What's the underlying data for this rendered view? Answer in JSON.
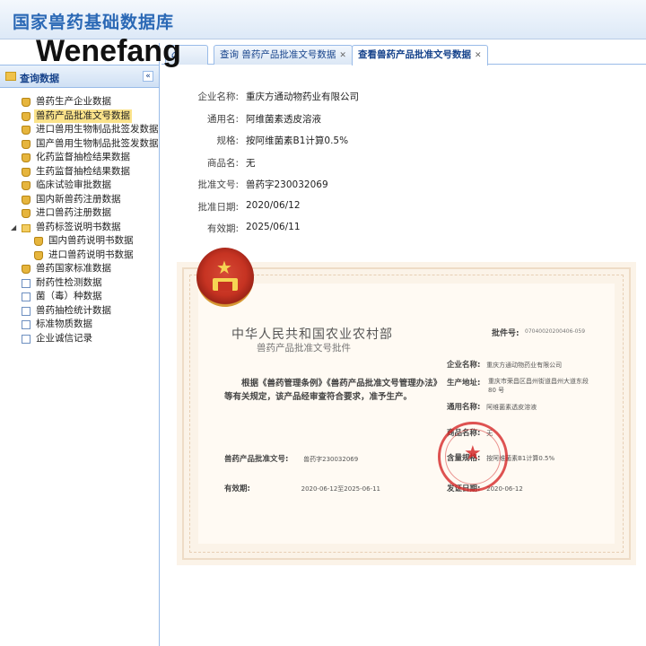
{
  "header": {
    "app_title": "国家兽药基础数据库",
    "watermark": "Wenefang"
  },
  "sidebar": {
    "title": "查询数据",
    "items": [
      {
        "label": "兽药生产企业数据",
        "icon": "database-icon",
        "level": 1
      },
      {
        "label": "兽药产品批准文号数据",
        "icon": "database-icon",
        "level": 1,
        "selected": true
      },
      {
        "label": "进口兽用生物制品批签发数据",
        "icon": "database-icon",
        "level": 1
      },
      {
        "label": "国产兽用生物制品批签发数据",
        "icon": "database-icon",
        "level": 1
      },
      {
        "label": "化药监督抽检结果数据",
        "icon": "database-icon",
        "level": 1
      },
      {
        "label": "生药监督抽检结果数据",
        "icon": "database-icon",
        "level": 1
      },
      {
        "label": "临床试验审批数据",
        "icon": "database-icon",
        "level": 1
      },
      {
        "label": "国内新兽药注册数据",
        "icon": "database-icon",
        "level": 1
      },
      {
        "label": "进口兽药注册数据",
        "icon": "database-icon",
        "level": 1
      },
      {
        "label": "兽药标签说明书数据",
        "icon": "folder-icon",
        "level": 1,
        "expanded": true
      },
      {
        "label": "国内兽药说明书数据",
        "icon": "database-icon",
        "level": 2
      },
      {
        "label": "进口兽药说明书数据",
        "icon": "database-icon",
        "level": 2
      },
      {
        "label": "兽药国家标准数据",
        "icon": "database-icon",
        "level": 1
      },
      {
        "label": "耐药性检测数据",
        "icon": "page-icon",
        "level": 1
      },
      {
        "label": "菌（毒）种数据",
        "icon": "page-icon",
        "level": 1
      },
      {
        "label": "兽药抽检统计数据",
        "icon": "page-icon",
        "level": 1
      },
      {
        "label": "标准物质数据",
        "icon": "page-icon",
        "level": 1
      },
      {
        "label": "企业诚信记录",
        "icon": "page-icon",
        "level": 1
      }
    ]
  },
  "tabs": [
    {
      "label": "查询 兽药产品批准文号数据",
      "closable": true,
      "active": false
    },
    {
      "label": "查看兽药产品批准文号数据",
      "closable": true,
      "active": true
    }
  ],
  "detail": {
    "fields": [
      {
        "label": "企业名称:",
        "value": "重庆方通动物药业有限公司"
      },
      {
        "label": "通用名:",
        "value": "阿维菌素透皮溶液"
      },
      {
        "label": "规格:",
        "value": "按阿维菌素B1计算0.5%"
      },
      {
        "label": "商品名:",
        "value": "无"
      },
      {
        "label": "批准文号:",
        "value": "兽药字230032069"
      },
      {
        "label": "批准日期:",
        "value": "2020/06/12"
      },
      {
        "label": "有效期:",
        "value": "2025/06/11"
      }
    ]
  },
  "certificate": {
    "title": "中华人民共和国农业农村部",
    "subtitle": "兽药产品批准文号批件",
    "permit_label": "批件号:",
    "permit_value": "07040020200406-059",
    "body": "根据《兽药管理条例》《兽药产品批准文号管理办法》等有关规定，该产品经审查符合要求，准予生产。",
    "approval_label": "兽药产品批准文号:",
    "approval_value": "兽药字230032069",
    "validity_label": "有效期:",
    "validity_value": "2020-06-12至2025-06-11",
    "company_label": "企业名称:",
    "company_value": "重庆方通动物药业有限公司",
    "address_label": "生产地址:",
    "address_value": "重庆市荣昌区昌州街道昌州大道东段 80 号",
    "generic_label": "通用名称:",
    "generic_value": "阿维菌素透皮溶液",
    "trade_label": "商品名称:",
    "trade_value": "无",
    "content_label": "含量规格:",
    "content_value": "按阿维菌素B1计算0.5%",
    "issue_label": "发证日期:",
    "issue_value": "2020-06-12"
  }
}
